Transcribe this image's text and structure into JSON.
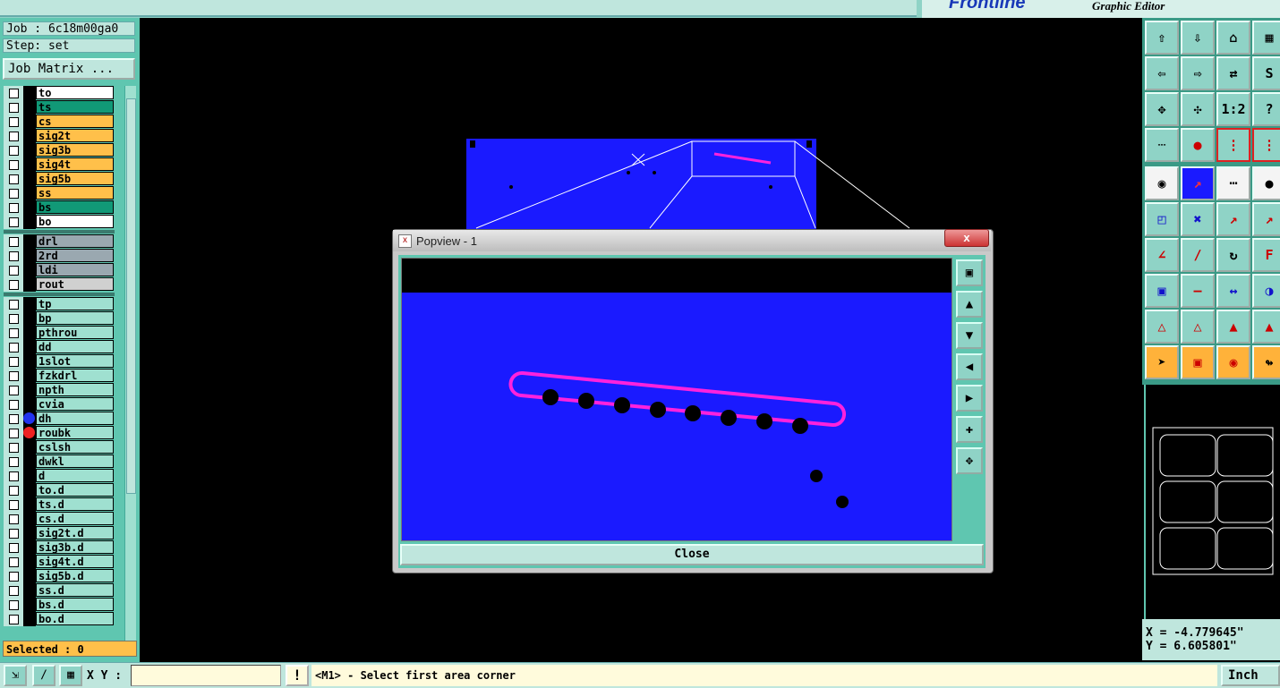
{
  "header": {
    "brand": "Frontline",
    "subtitle": "Graphic Editor"
  },
  "job": {
    "job_label": "Job : 6c18m00ga0",
    "step_label": "Step: set",
    "matrix_button": "Job Matrix ..."
  },
  "layers": [
    {
      "name": "to",
      "color": "#ffffff",
      "dot": ""
    },
    {
      "name": "ts",
      "color": "#119977",
      "dot": ""
    },
    {
      "name": "cs",
      "color": "#ffc04a",
      "dot": ""
    },
    {
      "name": "sig2t",
      "color": "#ffc04a",
      "dot": ""
    },
    {
      "name": "sig3b",
      "color": "#ffc04a",
      "dot": ""
    },
    {
      "name": "sig4t",
      "color": "#ffc04a",
      "dot": ""
    },
    {
      "name": "sig5b",
      "color": "#ffc04a",
      "dot": ""
    },
    {
      "name": "ss",
      "color": "#ffc04a",
      "dot": ""
    },
    {
      "name": "bs",
      "color": "#119977",
      "dot": ""
    },
    {
      "name": "bo",
      "color": "#ffffff",
      "dot": ""
    },
    {
      "name": "drl",
      "color": "#9aa8b0",
      "dot": ""
    },
    {
      "name": "2rd",
      "color": "#9aa8b0",
      "dot": ""
    },
    {
      "name": "ldi",
      "color": "#9aa8b0",
      "dot": ""
    },
    {
      "name": "rout",
      "color": "#d0d0d0",
      "dot": ""
    },
    {
      "name": "tp",
      "color": "#9fe0d0",
      "dot": ""
    },
    {
      "name": "bp",
      "color": "#9fe0d0",
      "dot": ""
    },
    {
      "name": "pthrou",
      "color": "#9fe0d0",
      "dot": ""
    },
    {
      "name": "dd",
      "color": "#9fe0d0",
      "dot": ""
    },
    {
      "name": "1slot",
      "color": "#9fe0d0",
      "dot": ""
    },
    {
      "name": "fzkdrl",
      "color": "#9fe0d0",
      "dot": ""
    },
    {
      "name": "npth",
      "color": "#9fe0d0",
      "dot": ""
    },
    {
      "name": "cvia",
      "color": "#9fe0d0",
      "dot": ""
    },
    {
      "name": "dh",
      "color": "#9fe0d0",
      "dot": "#2233ee"
    },
    {
      "name": "roubk",
      "color": "#9fe0d0",
      "dot": "#ee2222"
    },
    {
      "name": "cslsh",
      "color": "#9fe0d0",
      "dot": ""
    },
    {
      "name": "dwkl",
      "color": "#9fe0d0",
      "dot": ""
    },
    {
      "name": "d",
      "color": "#9fe0d0",
      "dot": ""
    },
    {
      "name": "to.d",
      "color": "#9fe0d0",
      "dot": ""
    },
    {
      "name": "ts.d",
      "color": "#9fe0d0",
      "dot": ""
    },
    {
      "name": "cs.d",
      "color": "#9fe0d0",
      "dot": ""
    },
    {
      "name": "sig2t.d",
      "color": "#9fe0d0",
      "dot": ""
    },
    {
      "name": "sig3b.d",
      "color": "#9fe0d0",
      "dot": ""
    },
    {
      "name": "sig4t.d",
      "color": "#9fe0d0",
      "dot": ""
    },
    {
      "name": "sig5b.d",
      "color": "#9fe0d0",
      "dot": ""
    },
    {
      "name": "ss.d",
      "color": "#9fe0d0",
      "dot": ""
    },
    {
      "name": "bs.d",
      "color": "#9fe0d0",
      "dot": ""
    },
    {
      "name": "bo.d",
      "color": "#9fe0d0",
      "dot": ""
    }
  ],
  "selected_label": "Selected : 0",
  "popview": {
    "title": "Popview - 1",
    "close_label": "Close",
    "close_x": "x"
  },
  "right_toolbar": {
    "one_to_two": "1:2",
    "help": "?"
  },
  "coords": {
    "x": "X = -4.779645\"",
    "y": "Y = 6.605801\""
  },
  "status": {
    "xy_label": "X Y :",
    "xy_value": "",
    "message": "<M1> - Select first area corner",
    "units": "Inch"
  },
  "colors": {
    "board": "#1a1aff",
    "slot": "#ff22dd",
    "panel": "#5fc6b0"
  }
}
